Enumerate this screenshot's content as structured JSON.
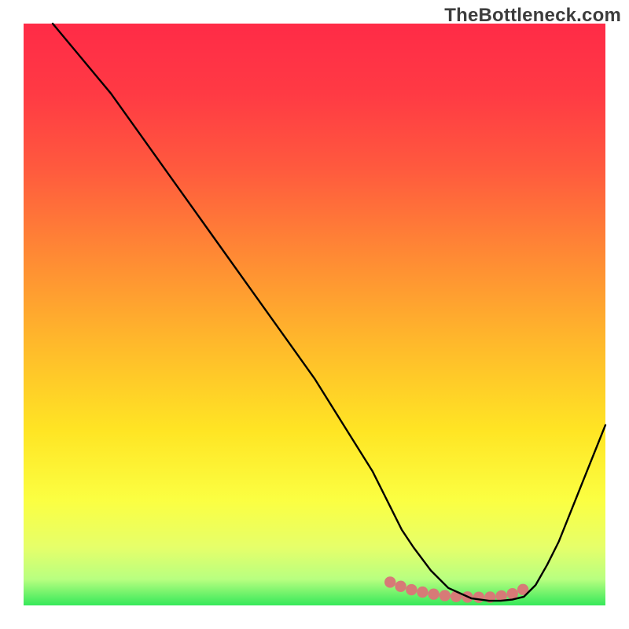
{
  "watermark": "TheBottleneck.com",
  "gradient": {
    "stops": [
      {
        "offset": 0.0,
        "color": "#ff2b47"
      },
      {
        "offset": 0.12,
        "color": "#ff3a44"
      },
      {
        "offset": 0.25,
        "color": "#ff5a3e"
      },
      {
        "offset": 0.4,
        "color": "#ff8a34"
      },
      {
        "offset": 0.55,
        "color": "#ffb92b"
      },
      {
        "offset": 0.7,
        "color": "#ffe524"
      },
      {
        "offset": 0.82,
        "color": "#fbff42"
      },
      {
        "offset": 0.9,
        "color": "#e6ff6a"
      },
      {
        "offset": 0.955,
        "color": "#b8ff80"
      },
      {
        "offset": 1.0,
        "color": "#36e85a"
      }
    ]
  },
  "chart_data": {
    "type": "line",
    "title": "",
    "xlabel": "",
    "ylabel": "",
    "xlim": [
      0,
      100
    ],
    "ylim": [
      0,
      100
    ],
    "series": [
      {
        "name": "bottleneck-curve",
        "style": "black-line",
        "x": [
          5,
          10,
          15,
          20,
          25,
          30,
          35,
          40,
          45,
          50,
          55,
          60,
          63,
          65,
          67,
          70,
          73,
          77,
          80,
          82,
          84,
          86,
          88,
          90,
          92,
          94,
          96,
          100
        ],
        "y": [
          100,
          94,
          88,
          81,
          74,
          67,
          60,
          53,
          46,
          39,
          31,
          23,
          17,
          13,
          10,
          6,
          3,
          1.2,
          0.8,
          0.8,
          1.0,
          1.5,
          3.5,
          7,
          11,
          16,
          21,
          31
        ]
      },
      {
        "name": "optimal-range-highlight",
        "style": "pink-dotted",
        "x": [
          63,
          65,
          67,
          70,
          73,
          77,
          80,
          82,
          84,
          86
        ],
        "y": [
          4.0,
          3.2,
          2.6,
          2.0,
          1.6,
          1.4,
          1.4,
          1.6,
          2.0,
          2.8
        ]
      }
    ]
  },
  "styles": {
    "black_line": {
      "stroke": "#000000",
      "width": 2.4
    },
    "pink_dot": {
      "fill": "#d77a77",
      "radius": 7.2
    }
  }
}
